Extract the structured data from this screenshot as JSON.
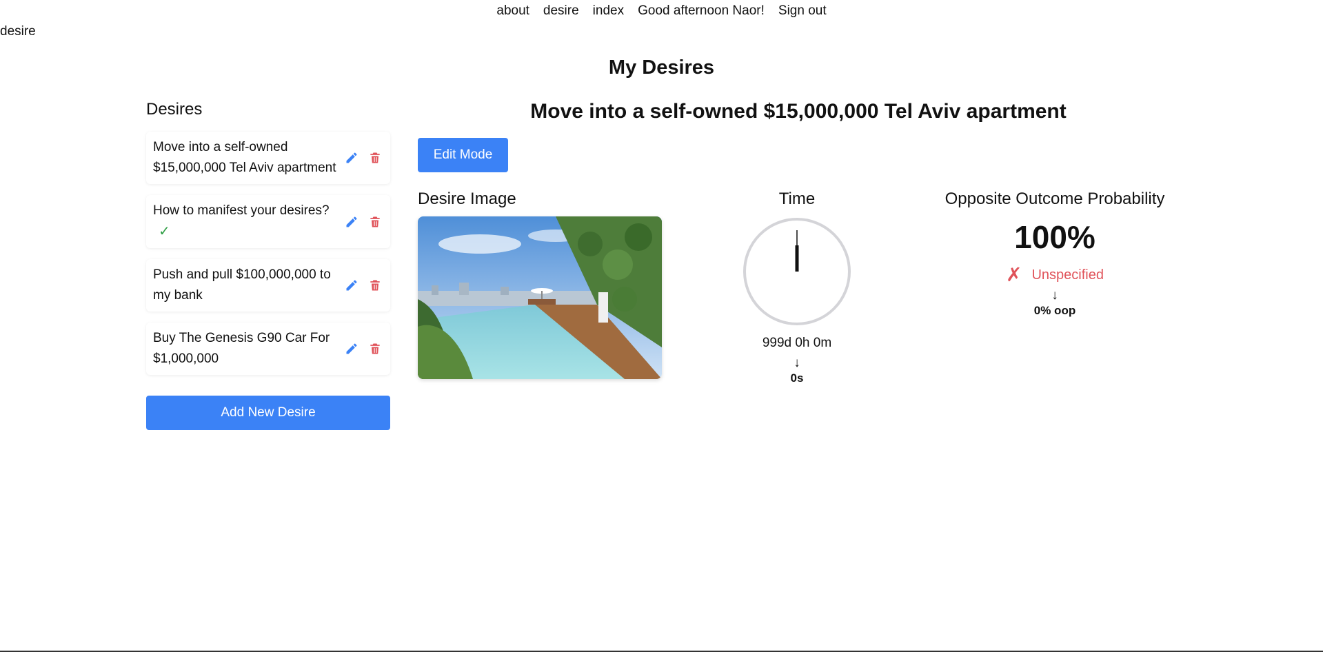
{
  "nav": {
    "links": [
      "about",
      "desire",
      "index"
    ],
    "greeting": "Good afternoon Naor!",
    "signout": "Sign out"
  },
  "route_label": "desire",
  "page_title": "My Desires",
  "sidebar": {
    "heading": "Desires",
    "items": [
      {
        "label": "Move into a self-owned $15,000,000 Tel Aviv apartment",
        "completed": false
      },
      {
        "label": "How to manifest your desires?",
        "completed": true,
        "check": "✓"
      },
      {
        "label": "Push and pull $100,000,000 to my bank",
        "completed": false
      },
      {
        "label": "Buy The Genesis G90 Car For $1,000,000",
        "completed": false
      }
    ],
    "add_button": "Add New Desire"
  },
  "main": {
    "desire_title": "Move into a self-owned $15,000,000 Tel Aviv apartment",
    "edit_button": "Edit Mode",
    "image_section": {
      "heading": "Desire Image",
      "image_description": "rooftop-infinity-pool-with-city-view"
    },
    "time_section": {
      "heading": "Time",
      "remaining": "999d 0h 0m",
      "arrow": "↓",
      "elapsed": "0s"
    },
    "probability_section": {
      "heading": "Opposite Outcome Probability",
      "value": "100%",
      "status_icon": "✗",
      "status": "Unspecified",
      "arrow": "↓",
      "oop": "0% oop"
    }
  },
  "colors": {
    "accent": "#3b82f6",
    "danger": "#e0535a",
    "success": "#2e9e44",
    "edit_icon": "#3b82f6",
    "delete_icon": "#e0535a"
  }
}
